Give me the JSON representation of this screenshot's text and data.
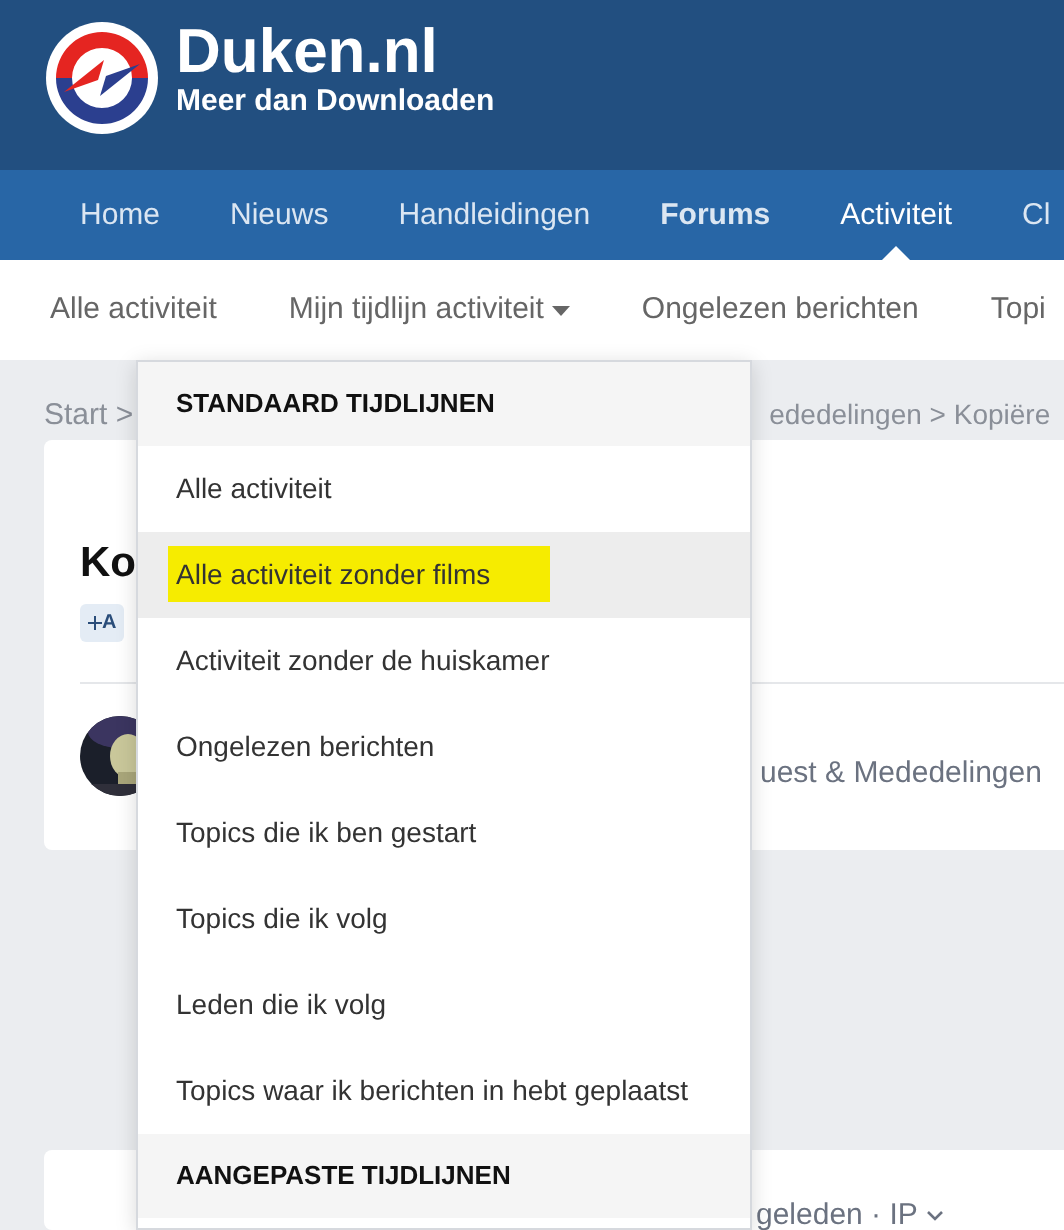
{
  "site": {
    "title": "Duken.nl",
    "tagline": "Meer dan Downloaden"
  },
  "nav": [
    {
      "label": "Home",
      "selected": false,
      "bold": false
    },
    {
      "label": "Nieuws",
      "selected": false,
      "bold": false
    },
    {
      "label": "Handleidingen",
      "selected": false,
      "bold": false
    },
    {
      "label": "Forums",
      "selected": false,
      "bold": true
    },
    {
      "label": "Activiteit",
      "selected": true,
      "bold": false
    },
    {
      "label": "Cl",
      "selected": false,
      "bold": false
    }
  ],
  "subnav": [
    {
      "label": "Alle activiteit",
      "dropdown": false
    },
    {
      "label": "Mijn tijdlijn activiteit",
      "dropdown": true
    },
    {
      "label": "Ongelezen berichten",
      "dropdown": false
    },
    {
      "label": "Topi",
      "dropdown": false
    }
  ],
  "breadcrumb": {
    "start": "Start",
    "separator": ">",
    "rest": "ededelingen > Kopiëre"
  },
  "topic": {
    "title": "Ko",
    "tag": "A",
    "forum_text": "uest & Mededelingen"
  },
  "post": {
    "meta": "geleden · IP"
  },
  "dropdown": [
    {
      "kind": "header",
      "label": "STANDAARD TIJDLIJNEN"
    },
    {
      "kind": "item",
      "label": "Alle activiteit",
      "hovered": false,
      "highlighted": false
    },
    {
      "kind": "item",
      "label": "Alle activiteit zonder films",
      "hovered": true,
      "highlighted": true
    },
    {
      "kind": "item",
      "label": "Activiteit zonder de huiskamer",
      "hovered": false,
      "highlighted": false
    },
    {
      "kind": "item",
      "label": "Ongelezen berichten",
      "hovered": false,
      "highlighted": false
    },
    {
      "kind": "item",
      "label": "Topics die ik ben gestart",
      "hovered": false,
      "highlighted": false
    },
    {
      "kind": "item",
      "label": "Topics die ik volg",
      "hovered": false,
      "highlighted": false
    },
    {
      "kind": "item",
      "label": "Leden die ik volg",
      "hovered": false,
      "highlighted": false
    },
    {
      "kind": "item",
      "label": "Topics waar ik berichten in hebt geplaatst",
      "hovered": false,
      "highlighted": false
    },
    {
      "kind": "header",
      "label": "AANGEPASTE TIJDLIJNEN"
    }
  ]
}
